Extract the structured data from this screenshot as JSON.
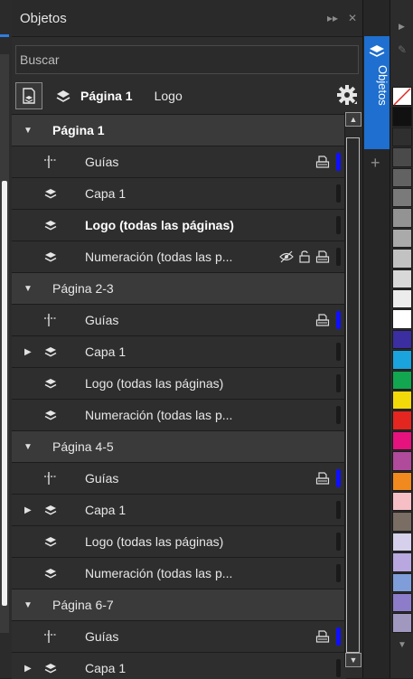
{
  "panel": {
    "title": "Objetos"
  },
  "search": {
    "placeholder": "Buscar"
  },
  "toolbar": {
    "page": "Página 1",
    "layer": "Logo"
  },
  "dock": {
    "tab_label": "Objetos"
  },
  "tree": [
    {
      "type": "page",
      "label": "Página 1",
      "bold": true
    },
    {
      "type": "layer",
      "icon": "guides-icon",
      "label": "Guías",
      "bold": false,
      "caret": false,
      "right_icons": [
        "print-icon"
      ],
      "indicator": "#1010ff"
    },
    {
      "type": "layer",
      "icon": "layer-icon",
      "label": "Capa 1",
      "bold": false,
      "caret": false,
      "right_icons": [],
      "indicator": "#1a1a1a"
    },
    {
      "type": "layer",
      "icon": "layer-icon",
      "label": "Logo (todas las páginas)",
      "bold": true,
      "caret": false,
      "right_icons": [],
      "indicator": "#1a1a1a"
    },
    {
      "type": "layer",
      "icon": "layer-icon",
      "label": "Numeración (todas las p...",
      "bold": false,
      "caret": false,
      "right_icons": [
        "eye-hidden-icon",
        "lock-open-icon",
        "print-icon"
      ],
      "indicator": "#1a1a1a"
    },
    {
      "type": "page",
      "label": "Página 2-3",
      "bold": false
    },
    {
      "type": "layer",
      "icon": "guides-icon",
      "label": "Guías",
      "bold": false,
      "caret": false,
      "right_icons": [
        "print-icon"
      ],
      "indicator": "#1010ff"
    },
    {
      "type": "layer",
      "icon": "layer-icon",
      "label": "Capa 1",
      "bold": false,
      "caret": true,
      "right_icons": [],
      "indicator": "#1a1a1a"
    },
    {
      "type": "layer",
      "icon": "layer-icon",
      "label": "Logo (todas las páginas)",
      "bold": false,
      "caret": false,
      "right_icons": [],
      "indicator": "#1a1a1a"
    },
    {
      "type": "layer",
      "icon": "layer-icon",
      "label": "Numeración (todas las p...",
      "bold": false,
      "caret": false,
      "right_icons": [],
      "indicator": "#1a1a1a"
    },
    {
      "type": "page",
      "label": "Página 4-5",
      "bold": false
    },
    {
      "type": "layer",
      "icon": "guides-icon",
      "label": "Guías",
      "bold": false,
      "caret": false,
      "right_icons": [
        "print-icon"
      ],
      "indicator": "#1010ff"
    },
    {
      "type": "layer",
      "icon": "layer-icon",
      "label": "Capa 1",
      "bold": false,
      "caret": true,
      "right_icons": [],
      "indicator": "#1a1a1a"
    },
    {
      "type": "layer",
      "icon": "layer-icon",
      "label": "Logo (todas las páginas)",
      "bold": false,
      "caret": false,
      "right_icons": [],
      "indicator": "#1a1a1a"
    },
    {
      "type": "layer",
      "icon": "layer-icon",
      "label": "Numeración (todas las p...",
      "bold": false,
      "caret": false,
      "right_icons": [],
      "indicator": "#1a1a1a"
    },
    {
      "type": "page",
      "label": "Página 6-7",
      "bold": false
    },
    {
      "type": "layer",
      "icon": "guides-icon",
      "label": "Guías",
      "bold": false,
      "caret": false,
      "right_icons": [
        "print-icon"
      ],
      "indicator": "#1010ff"
    },
    {
      "type": "layer",
      "icon": "layer-icon",
      "label": "Capa 1",
      "bold": false,
      "caret": true,
      "right_icons": [],
      "indicator": "#1a1a1a"
    }
  ],
  "palette": [
    "none",
    "#111111",
    "#2f2f2f",
    "#4a4a4a",
    "#626262",
    "#7a7a7a",
    "#939393",
    "#aaaaaa",
    "#c2c2c2",
    "#d8d8d8",
    "#ececec",
    "#ffffff",
    "#3a2ea0",
    "#1aa3dc",
    "#12a650",
    "#f2d90a",
    "#e3261f",
    "#e6127e",
    "#b04a9a",
    "#f08a1e",
    "#f6bfc6",
    "#7a6d63",
    "#d6d0ec",
    "#b8a8df",
    "#7f9dd8",
    "#8c7cc9",
    "#a198c0"
  ]
}
